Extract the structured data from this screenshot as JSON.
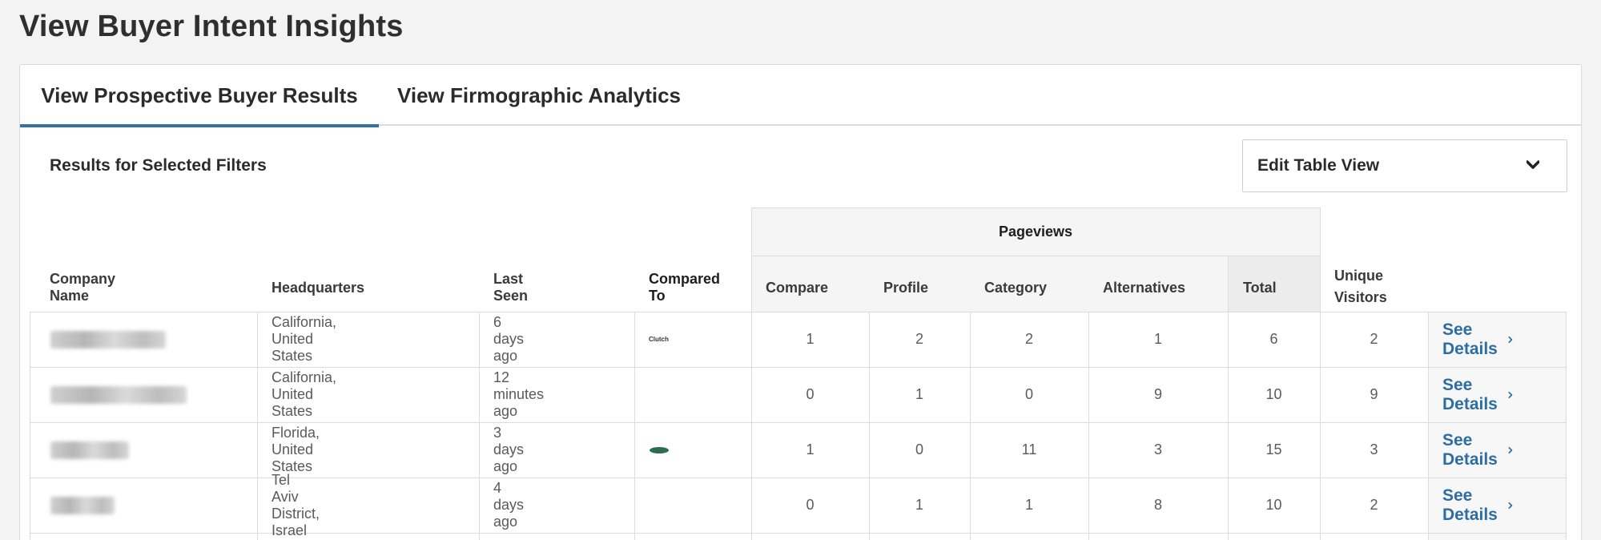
{
  "page": {
    "title": "View Buyer Intent Insights"
  },
  "tabs": [
    {
      "label": "View Prospective Buyer Results",
      "active": true
    },
    {
      "label": "View Firmographic Analytics",
      "active": false
    }
  ],
  "results": {
    "label": "Results for Selected Filters"
  },
  "edit_table": {
    "label": "Edit Table View",
    "icon": "chevron-down-icon"
  },
  "table": {
    "group_header": "Pageviews",
    "columns": {
      "company": "Company Name",
      "hq": "Headquarters",
      "last_seen": "Last Seen",
      "compared_to": "Compared To",
      "compare": "Compare",
      "profile": "Profile",
      "category": "Category",
      "alternatives": "Alternatives",
      "total": "Total",
      "unique_visitors": "Unique Visitors"
    },
    "rows": [
      {
        "hq": "California, United States",
        "last_seen": "6 days ago",
        "compared_to": "Clutch",
        "compare": "1",
        "profile": "2",
        "category": "2",
        "alternatives": "1",
        "total": "6",
        "unique": "2",
        "action": "See Details"
      },
      {
        "hq": "California, United States",
        "last_seen": "12 minutes ago",
        "compared_to": "",
        "compare": "0",
        "profile": "1",
        "category": "0",
        "alternatives": "9",
        "total": "10",
        "unique": "9",
        "action": "See Details"
      },
      {
        "hq": "Florida, United States",
        "last_seen": "3 days ago",
        "compared_to": "",
        "compare": "1",
        "profile": "0",
        "category": "11",
        "alternatives": "3",
        "total": "15",
        "unique": "3",
        "action": "See Details"
      },
      {
        "hq": "Tel Aviv District, Israel",
        "last_seen": "4 days ago",
        "compared_to": "",
        "compare": "0",
        "profile": "1",
        "category": "1",
        "alternatives": "8",
        "total": "10",
        "unique": "2",
        "action": "See Details"
      }
    ]
  },
  "colors": {
    "accent": "#2f72a8",
    "link": "#2c6ea4",
    "logo_green": "#2e6b50"
  }
}
